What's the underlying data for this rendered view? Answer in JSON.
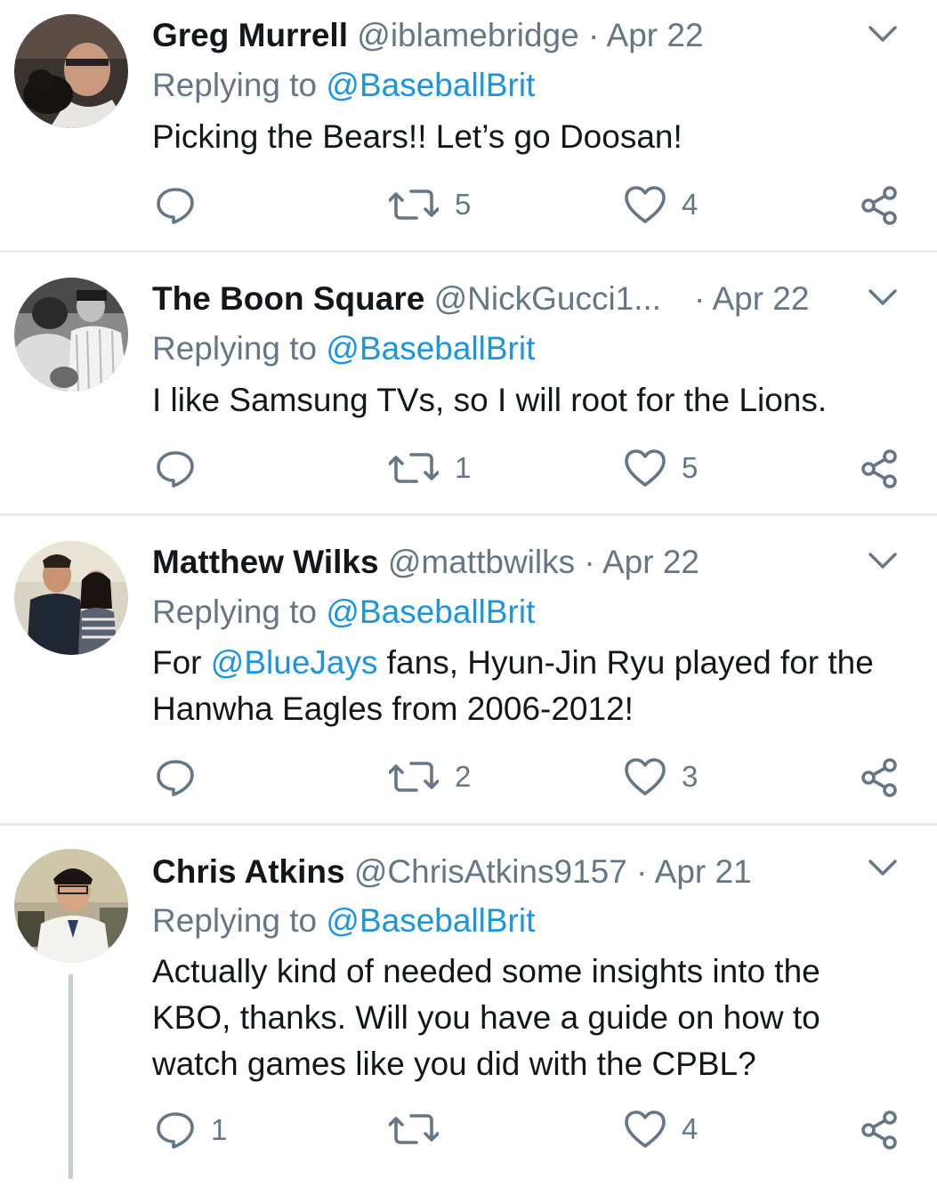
{
  "tweets": [
    {
      "name": "Greg Murrell",
      "handle": "@iblamebridge",
      "sep": " · ",
      "date": "Apr 22",
      "replying_prefix": "Replying to ",
      "replying_to": "@BaseballBrit",
      "body": "Picking the Bears!!  Let’s go Doosan!",
      "reply_count": "",
      "retweet_count": "5",
      "like_count": "4"
    },
    {
      "name": "The Boon Square",
      "handle": "@NickGucci1...",
      "sep": " · ",
      "date": "Apr 22",
      "replying_prefix": "Replying to ",
      "replying_to": "@BaseballBrit",
      "body": "I like Samsung TVs, so I will root for the Lions.",
      "reply_count": "",
      "retweet_count": "1",
      "like_count": "5"
    },
    {
      "name": "Matthew Wilks",
      "handle": "@mattbwilks",
      "sep": " · ",
      "date": "Apr 22",
      "replying_prefix": "Replying to ",
      "replying_to": "@BaseballBrit",
      "body_prefix": "For ",
      "body_mention": "@BlueJays",
      "body_rest_line1": " fans, Hyun-Jin Ryu played for the",
      "body_line2": "Hanwha Eagles from 2006-2012!",
      "reply_count": "",
      "retweet_count": "2",
      "like_count": "3"
    },
    {
      "name": "Chris Atkins",
      "handle": "@ChrisAtkins9157",
      "sep": " · ",
      "date": "Apr 21",
      "replying_prefix": "Replying to ",
      "replying_to": "@BaseballBrit",
      "body_line1": "Actually kind of needed some insights into the",
      "body_line2": "KBO, thanks. Will you have a guide on how to",
      "body_line3": "watch games like you did with the CPBL?",
      "reply_count": "1",
      "retweet_count": "",
      "like_count": "4"
    }
  ],
  "icons": {
    "reply": "reply-icon",
    "retweet": "retweet-icon",
    "like": "heart-icon",
    "share": "share-icon",
    "menu": "chevron-down-icon"
  },
  "colors": {
    "name": "#14171a",
    "muted": "#657786",
    "mention": "#1b95e0",
    "divider": "#e6ecf0"
  }
}
